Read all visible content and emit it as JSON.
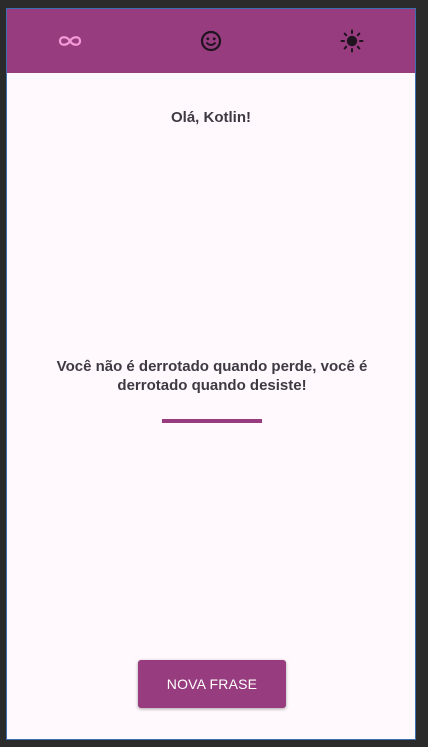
{
  "colors": {
    "primary": "#973c7e",
    "background": "#fff8fc",
    "text": "#3e3a44",
    "accent_icon": "#f59ad8"
  },
  "tabs": [
    {
      "icon": "infinity-icon",
      "selected": true
    },
    {
      "icon": "smiley-face-icon",
      "selected": false
    },
    {
      "icon": "sun-icon",
      "selected": false
    }
  ],
  "main": {
    "greeting": "Olá, Kotlin!",
    "quote": "Você não é derrotado quando perde, você é derrotado quando desiste!"
  },
  "button": {
    "label": "NOVA FRASE"
  }
}
